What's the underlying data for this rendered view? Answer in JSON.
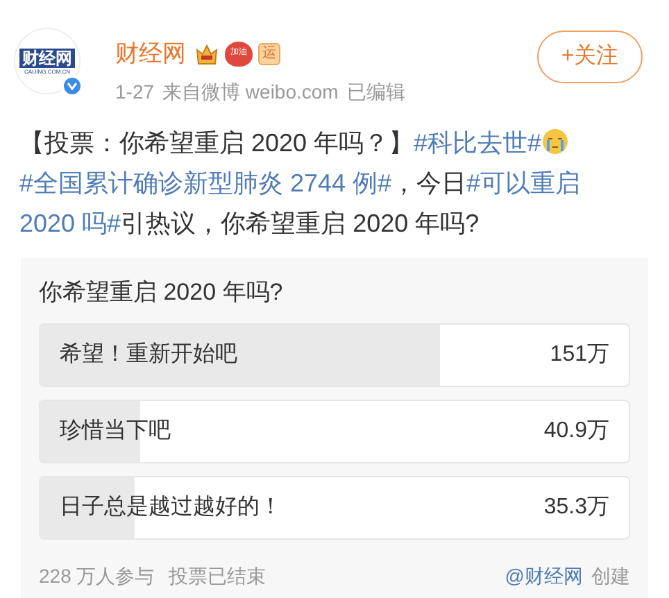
{
  "author": {
    "name": "财经网",
    "logo_text": "财经网",
    "logo_subtext": "CAIJING.COM.CN",
    "verified": true,
    "badges": [
      {
        "kind": "crown"
      },
      {
        "kind": "heart",
        "text": "加油"
      },
      {
        "kind": "tile",
        "text": "运"
      }
    ],
    "date": "1-27",
    "source": "来自微博 weibo.com",
    "edited": "已编辑"
  },
  "follow_button": "+关注",
  "post": [
    {
      "kind": "text",
      "text": "【投票：你希望重启 2020 年吗？】"
    },
    {
      "kind": "tag",
      "text": "#科比去世#"
    },
    {
      "kind": "emoji"
    },
    {
      "kind": "tag",
      "text": "#全国累计确诊新型肺炎 2744 例#"
    },
    {
      "kind": "text",
      "text": "，今日"
    },
    {
      "kind": "tag",
      "text": "#可以重启"
    },
    {
      "kind": "tag",
      "text": "2020 吗#"
    },
    {
      "kind": "text",
      "text": "引热议，你希望重启 2020 年吗?"
    }
  ],
  "poll": {
    "question": "你希望重启 2020 年吗?",
    "options": [
      {
        "label": "希望！重新开始吧",
        "count": "151万",
        "level": 0.68
      },
      {
        "label": "珍惜当下吧",
        "count": "40.9万",
        "level": 0.17
      },
      {
        "label": "日子总是越过越好的！",
        "count": "35.3万",
        "level": 0.16
      }
    ],
    "participants": "228 万人参与",
    "status": "投票已结束",
    "creator": "@财经网",
    "created": "创建"
  }
}
